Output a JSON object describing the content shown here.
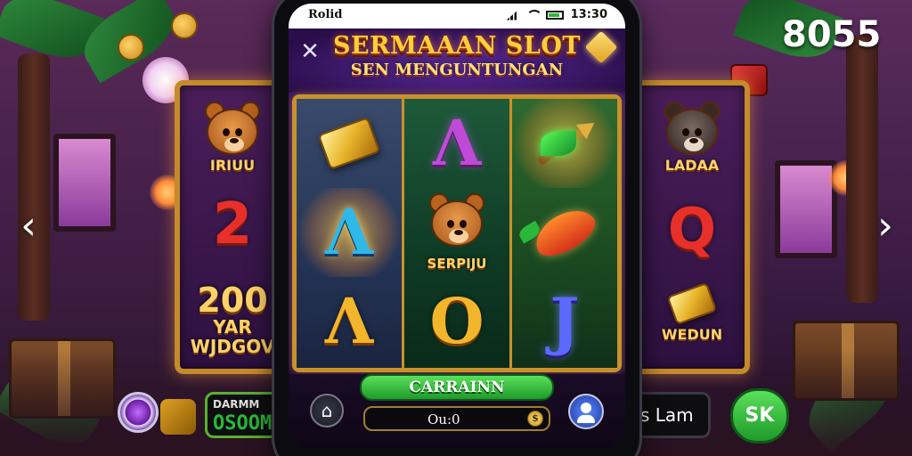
{
  "counter": "8055",
  "nav": {
    "prev_label": "‹",
    "next_label": "›"
  },
  "status_bar": {
    "left_text": "Rolid",
    "time": "13:30"
  },
  "header": {
    "title": "SERMAAAN SLOT",
    "subtitle": "SEN MENGUNTUNGAN",
    "close_label": "✕"
  },
  "reels": {
    "reel_1": {
      "sym_top": "gold-bar",
      "sym_mid": "Λ",
      "sym_bot": "Λ"
    },
    "reel_2": {
      "sym_top": "Λ",
      "sym_mid_label": "SERPIJU",
      "sym_bot": "Ο"
    },
    "reel_3": {
      "sym_top": "arrow",
      "sym_mid": "chili",
      "sym_bot": "J"
    }
  },
  "controls": {
    "spin_label": "CARRAINN",
    "bet_value": "Ou:0",
    "coin_symbol": "$",
    "home_label": "⌂"
  },
  "side_left": {
    "caption_top": "IRIUU",
    "glyph_mid": "2",
    "number": "200",
    "line_1": "YAR",
    "line_2": "WJDGOV"
  },
  "side_right": {
    "caption_top": "LADAA",
    "glyph_mid": "Q",
    "caption_bot": "WEDUN"
  },
  "external": {
    "left_box_line_1": "DARMM",
    "left_box_line_2": "OSOOM",
    "right_box_text": "s Lam",
    "ok_label": "SK"
  },
  "colors": {
    "frame_gold": "#c9912c",
    "spin_green": "#1e9a2a",
    "title_gold": "#ffcf3a"
  }
}
